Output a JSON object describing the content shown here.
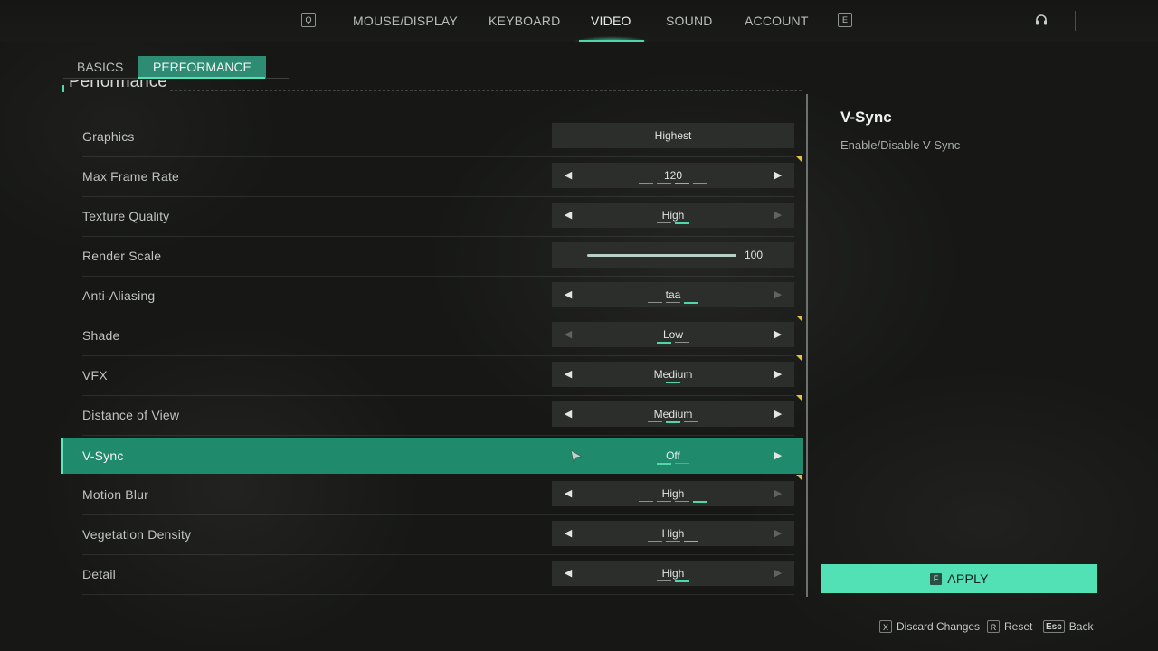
{
  "nav": {
    "prev_key": "Q",
    "next_key": "E",
    "tabs": [
      {
        "label": "MOUSE/DISPLAY"
      },
      {
        "label": "KEYBOARD"
      },
      {
        "label": "VIDEO",
        "active": true
      },
      {
        "label": "SOUND"
      },
      {
        "label": "ACCOUNT"
      }
    ]
  },
  "subtabs": {
    "basics": "BASICS",
    "performance": "PERFORMANCE",
    "active": "PERFORMANCE"
  },
  "section_title": "Performance",
  "settings": [
    {
      "label": "Graphics",
      "value": "Highest"
    },
    {
      "label": "Max Frame Rate",
      "value": "120",
      "options_count": 4,
      "selected_index": 2
    },
    {
      "label": "Texture Quality",
      "value": "High",
      "options_count": 2,
      "selected_index": 1
    },
    {
      "label": "Render Scale",
      "value": "100",
      "slider_fraction": 1.0
    },
    {
      "label": "Anti-Aliasing",
      "value": "taa",
      "options_count": 3,
      "selected_index": 2
    },
    {
      "label": "Shade",
      "value": "Low",
      "options_count": 2,
      "selected_index": 0
    },
    {
      "label": "VFX",
      "value": "Medium",
      "options_count": 5,
      "selected_index": 2
    },
    {
      "label": "Distance of View",
      "value": "Medium",
      "options_count": 3,
      "selected_index": 1
    },
    {
      "label": "V-Sync",
      "value": "Off",
      "options_count": 2,
      "selected_index": 0,
      "selected": true
    },
    {
      "label": "Motion Blur",
      "value": "High",
      "options_count": 4,
      "selected_index": 3
    },
    {
      "label": "Vegetation Density",
      "value": "High",
      "options_count": 3,
      "selected_index": 2
    },
    {
      "label": "Detail",
      "value": "High",
      "options_count": 2,
      "selected_index": 1
    }
  ],
  "help": {
    "title": "V-Sync",
    "description": "Enable/Disable V-Sync"
  },
  "apply": {
    "key": "F",
    "label": "APPLY"
  },
  "footer": {
    "discard_key": "X",
    "discard_label": "Discard Changes",
    "reset_key": "R",
    "reset_label": "Reset",
    "back_key": "Esc",
    "back_label": "Back"
  },
  "colors": {
    "accent": "#4fd6ad",
    "selected_row": "#1f8a6c",
    "apply_button": "#52e0b5",
    "changed_marker": "#e2c33c"
  },
  "icons": [
    "chevron-left-icon",
    "chevron-right-icon",
    "headset-icon",
    "cursor-icon"
  ]
}
